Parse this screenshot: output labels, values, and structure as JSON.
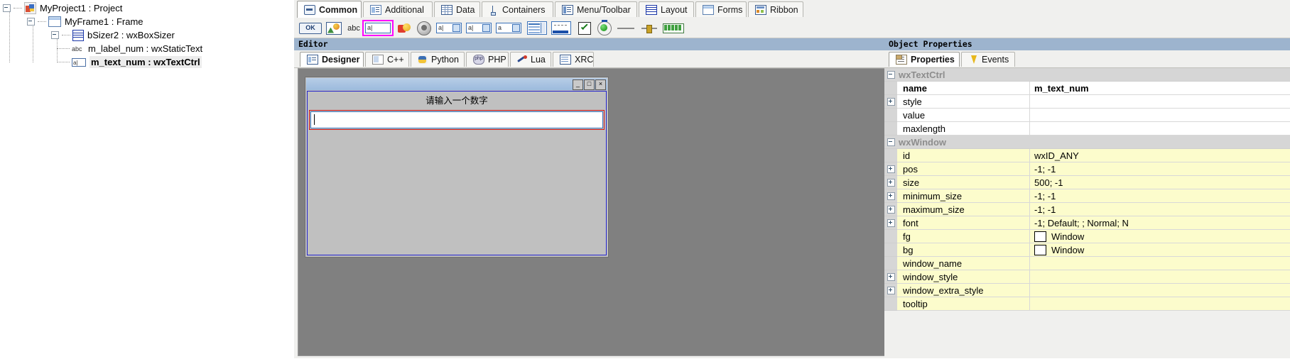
{
  "tree": {
    "nodes": [
      {
        "label": "MyProject1 : Project",
        "icon": "project-icon",
        "indent": 0,
        "expander": "minus",
        "selected": false
      },
      {
        "label": "MyFrame1 : Frame",
        "icon": "frame-icon",
        "indent": 1,
        "expander": "minus",
        "selected": false
      },
      {
        "label": "bSizer2 : wxBoxSizer",
        "icon": "sizer-icon",
        "indent": 2,
        "expander": "minus",
        "selected": false
      },
      {
        "label": "m_label_num : wxStaticText",
        "icon": "abc-icon",
        "indent": 3,
        "expander": "none",
        "selected": false
      },
      {
        "label": "m_text_num : wxTextCtrl",
        "icon": "textctrl-icon",
        "indent": 3,
        "expander": "none",
        "selected": true
      }
    ]
  },
  "palette": {
    "tabs": [
      {
        "label": "Common",
        "icon": "common-icon",
        "active": true
      },
      {
        "label": "Additional",
        "icon": "additional-icon",
        "active": false
      },
      {
        "label": "Data",
        "icon": "data-icon",
        "active": false
      },
      {
        "label": "Containers",
        "icon": "containers-icon",
        "active": false
      },
      {
        "label": "Menu/Toolbar",
        "icon": "menu-toolbar-icon",
        "active": false
      },
      {
        "label": "Layout",
        "icon": "layout-icon",
        "active": false
      },
      {
        "label": "Forms",
        "icon": "forms-icon",
        "active": false
      },
      {
        "label": "Ribbon",
        "icon": "ribbon-icon",
        "active": false
      }
    ],
    "items": [
      {
        "name": "wxButton",
        "icon": "button-icon",
        "selected": false
      },
      {
        "name": "wxBitmapButton",
        "icon": "bitmap-button-icon",
        "selected": false
      },
      {
        "name": "wxStaticText",
        "icon": "static-text-icon",
        "selected": false
      },
      {
        "name": "wxTextCtrl",
        "icon": "text-ctrl-icon",
        "selected": true
      },
      {
        "name": "wxComboBox",
        "icon": "combo-box-icon",
        "selected": false
      },
      {
        "name": "wxBitmapComboBox",
        "icon": "gauge-icon",
        "selected": false
      },
      {
        "name": "wxChoice",
        "icon": "choice-icon",
        "selected": false
      },
      {
        "name": "wxListBox",
        "icon": "list-box-icon",
        "selected": false
      },
      {
        "name": "wxSpinCtrl",
        "icon": "spin-ctrl-icon",
        "selected": false
      },
      {
        "name": "wxListCtrl",
        "icon": "list-ctrl-icon",
        "selected": false
      },
      {
        "name": "wxPanel",
        "icon": "panel-icon",
        "selected": false
      },
      {
        "name": "wxCheckBox",
        "icon": "check-box-icon",
        "selected": false
      },
      {
        "name": "wxRadioButton",
        "icon": "radio-button-icon",
        "selected": false
      },
      {
        "name": "wxStaticLine",
        "icon": "static-line-icon",
        "selected": false
      },
      {
        "name": "wxSlider",
        "icon": "slider-icon",
        "selected": false
      },
      {
        "name": "wxGauge",
        "icon": "progress-icon",
        "selected": false
      }
    ]
  },
  "editor": {
    "caption": "Editor",
    "tabs": [
      {
        "label": "Designer",
        "icon": "designer-icon",
        "active": true
      },
      {
        "label": "C++",
        "icon": "cpp-icon",
        "active": false
      },
      {
        "label": "Python",
        "icon": "python-icon",
        "active": false
      },
      {
        "label": "PHP",
        "icon": "php-icon",
        "active": false
      },
      {
        "label": "Lua",
        "icon": "lua-icon",
        "active": false
      },
      {
        "label": "XRC",
        "icon": "xrc-icon",
        "active": false
      }
    ]
  },
  "designer": {
    "window": {
      "title": "",
      "buttons": [
        {
          "label": "_",
          "name": "minimize-button"
        },
        {
          "label": "□",
          "name": "maximize-button"
        },
        {
          "label": "×",
          "name": "close-button"
        }
      ]
    },
    "static_text": "请输入一个数字",
    "text_ctrl_value": ""
  },
  "properties": {
    "caption": "Object Properties",
    "tabs": [
      {
        "label": "Properties",
        "icon": "properties-icon",
        "active": true
      },
      {
        "label": "Events",
        "icon": "events-icon",
        "active": false
      }
    ],
    "rows": [
      {
        "kind": "category",
        "name": "wxTextCtrl",
        "expander": "minus"
      },
      {
        "kind": "prop",
        "name": "name",
        "value": "m_text_num",
        "expander": "none",
        "bold": true,
        "yellow": false
      },
      {
        "kind": "prop",
        "name": "style",
        "value": "",
        "expander": "plus",
        "bold": false,
        "yellow": false
      },
      {
        "kind": "prop",
        "name": "value",
        "value": "",
        "expander": "none",
        "bold": false,
        "yellow": false
      },
      {
        "kind": "prop",
        "name": "maxlength",
        "value": "",
        "expander": "none",
        "bold": false,
        "yellow": false
      },
      {
        "kind": "category",
        "name": "wxWindow",
        "expander": "minus"
      },
      {
        "kind": "prop",
        "name": "id",
        "value": "wxID_ANY",
        "expander": "none",
        "bold": false,
        "yellow": true
      },
      {
        "kind": "prop",
        "name": "pos",
        "value": "-1; -1",
        "expander": "plus",
        "bold": false,
        "yellow": true
      },
      {
        "kind": "prop",
        "name": "size",
        "value": "500; -1",
        "expander": "plus",
        "bold": false,
        "yellow": true
      },
      {
        "kind": "prop",
        "name": "minimum_size",
        "value": "-1; -1",
        "expander": "plus",
        "bold": false,
        "yellow": true
      },
      {
        "kind": "prop",
        "name": "maximum_size",
        "value": "-1; -1",
        "expander": "plus",
        "bold": false,
        "yellow": true
      },
      {
        "kind": "prop",
        "name": "font",
        "value": "-1; Default; ; Normal; N",
        "expander": "plus",
        "bold": false,
        "yellow": true
      },
      {
        "kind": "prop",
        "name": "fg",
        "value": "Window",
        "expander": "none",
        "bold": false,
        "yellow": true,
        "swatch": "#ffffff"
      },
      {
        "kind": "prop",
        "name": "bg",
        "value": "Window",
        "expander": "none",
        "bold": false,
        "yellow": true,
        "swatch": "#ffffff"
      },
      {
        "kind": "prop",
        "name": "window_name",
        "value": "",
        "expander": "none",
        "bold": false,
        "yellow": true
      },
      {
        "kind": "prop",
        "name": "window_style",
        "value": "",
        "expander": "plus",
        "bold": false,
        "yellow": true
      },
      {
        "kind": "prop",
        "name": "window_extra_style",
        "value": "",
        "expander": "plus",
        "bold": false,
        "yellow": true
      },
      {
        "kind": "prop",
        "name": "tooltip",
        "value": "",
        "expander": "none",
        "bold": false,
        "yellow": true
      }
    ]
  },
  "colors": {
    "caption_bar": "#9db4ce",
    "canvas": "#808080",
    "property_yellow": "#fcfccc",
    "selection_magenta": "#ff00ff",
    "sizer_red": "#d01616",
    "form_blue": "#2222cc"
  }
}
